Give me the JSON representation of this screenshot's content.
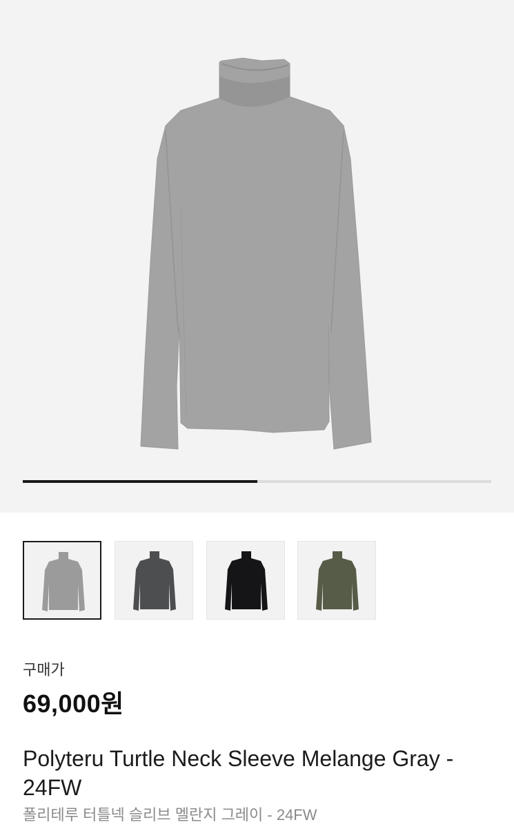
{
  "product": {
    "price_label": "구매가",
    "price": "69,000원",
    "name_en": "Polyteru Turtle Neck Sleeve Melange Gray - 24FW",
    "name_ko": "폴리테루 터틀넥 슬리브 멜란지 그레이 - 24FW",
    "image_alt": "gray turtleneck long sleeve shirt"
  },
  "gallery": {
    "progress_fraction": 0.5,
    "selected_index": 0,
    "thumbnails": [
      {
        "color_name": "gray",
        "fill": "#9b9b9b"
      },
      {
        "color_name": "charcoal",
        "fill": "#4d4e50"
      },
      {
        "color_name": "black",
        "fill": "#151517"
      },
      {
        "color_name": "khaki",
        "fill": "#575c48"
      }
    ]
  },
  "colors": {
    "hero_background": "#f3f3f3",
    "shirt_main": "#a3a3a3",
    "accent_dark": "#1a1a1a"
  }
}
